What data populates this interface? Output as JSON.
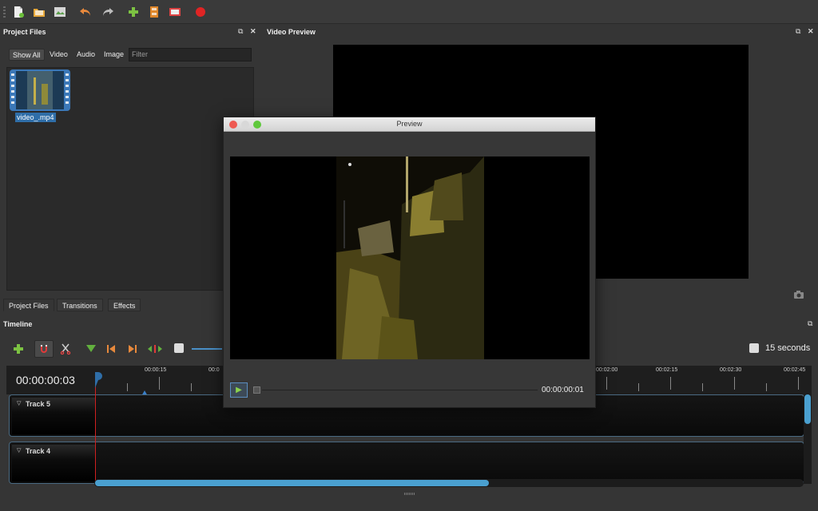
{
  "toolbar": {
    "icons": [
      "new-project-icon",
      "open-project-icon",
      "save-project-icon",
      "undo-icon",
      "redo-icon",
      "import-files-icon",
      "choose-profile-icon",
      "fullscreen-icon",
      "export-video-icon"
    ]
  },
  "project_files": {
    "title": "Project Files",
    "filters": [
      "Show All",
      "Video",
      "Audio",
      "Image"
    ],
    "filter_placeholder": "Filter",
    "file_name": "video_.mp4"
  },
  "bottom_tabs": [
    "Project Files",
    "Transitions",
    "Effects"
  ],
  "video_preview": {
    "title": "Video Preview"
  },
  "timeline": {
    "title": "Timeline",
    "timecode": "00:00:00:03",
    "zoom_label": "15 seconds",
    "ticks": [
      "00:00:15",
      "00:0",
      "00:02:00",
      "00:02:15",
      "00:02:30",
      "00:02:45"
    ],
    "tracks": [
      "Track 5",
      "Track 4"
    ]
  },
  "dialog": {
    "title": "Preview",
    "time": "00:00:00:01"
  },
  "colors": {
    "accent": "#2f6ea8",
    "playhead": "#d02020",
    "scrollbar": "#4aa0d0"
  }
}
